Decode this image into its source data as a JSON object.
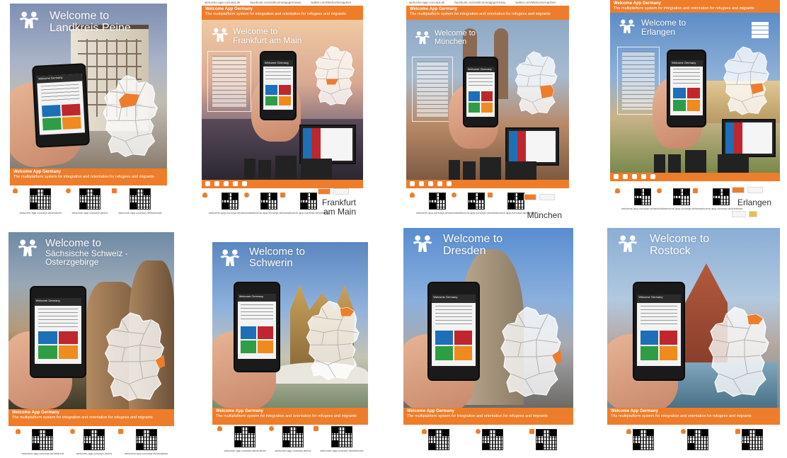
{
  "shared": {
    "band_title": "Welcome App Germany",
    "band_subtitle": "The multiplatform system for integration and orientation for refugees and migrants",
    "phone_screen_title": "Welcome Germany",
    "icons": [
      "people-logo-icon",
      "android-icon",
      "apple-icon",
      "windows-icon",
      "germany-map-icon",
      "smartphone-icon"
    ],
    "colors": {
      "orange": "#ee7d2b",
      "tile_blue": "#1d6fb8",
      "tile_red": "#c0262d",
      "tile_green": "#2f9d46",
      "tile_orange": "#ef8a1e"
    }
  },
  "posters": [
    {
      "id": "peine",
      "welcome_line1": "Welcome to",
      "welcome_line2": "Landkreis Peine",
      "qr_urls": [
        "welcome-app-concept.de/android",
        "welcome-app-concept.de/ios",
        "welcome-app-concept.de/windows"
      ]
    },
    {
      "id": "frankfurt",
      "header_links": [
        "welcome-app-concept.de",
        "facebook.com/welcomeappgermany",
        "twitter.com/WelcomeAppGer"
      ],
      "welcome_line1": "Welcome to",
      "welcome_line2": "Frankfurt am Main",
      "city_name_line1": "Frankfurt",
      "city_name_line2": "am Main",
      "qr_urls": [
        "welcome-app-concept.de/android",
        "welcome-app-concept.de/ios",
        "welcome-app-concept.de/windows"
      ]
    },
    {
      "id": "muenchen",
      "header_links": [
        "welcome-app-concept.de",
        "facebook.com/welcomeappgermany",
        "twitter.com/WelcomeAppGer"
      ],
      "welcome_line1": "Welcome to",
      "welcome_line2": "München",
      "city_name_line1": "München",
      "qr_urls": [
        "welcome-app-concept.de/android",
        "welcome-app-concept.de/ios",
        "welcome-app-concept.de/windows"
      ]
    },
    {
      "id": "erlangen",
      "welcome_line1": "Welcome to",
      "welcome_line2": "Erlangen",
      "city_name_line1": "Erlangen",
      "qr_urls": [
        "welcome-app-concept.de/android",
        "welcome-app-concept.de/ios",
        "welcome-app-concept.de/windows"
      ]
    },
    {
      "id": "saechsische-schweiz",
      "welcome_line1": "Welcome to",
      "welcome_line2": "Sächsische Schweiz -",
      "welcome_line3": "Osterzgebirge",
      "qr_urls": [
        "welcome-app-concept.de/android",
        "welcome-app-concept.de/ios",
        "welcome-app-concept.de/windows"
      ]
    },
    {
      "id": "schwerin",
      "welcome_line1": "Welcome to",
      "welcome_line2": "Schwerin",
      "qr_urls": [
        "welcome-app-concept.de/android",
        "welcome-app-concept.de/ios",
        "welcome-app-concept.de/windows"
      ]
    },
    {
      "id": "dresden",
      "welcome_line1": "Welcome to",
      "welcome_line2": "Dresden",
      "qr_urls": [
        "welcome-app-concept.de/android",
        "welcome-app-concept.de/ios",
        "welcome-app-concept.de/windows"
      ]
    },
    {
      "id": "rostock",
      "welcome_line1": "Welcome to",
      "welcome_line2": "Rostock",
      "qr_urls": [
        "welcome-app-concept.de/android",
        "welcome-app-concept.de/ios",
        "welcome-app-concept.de/windows"
      ]
    }
  ]
}
